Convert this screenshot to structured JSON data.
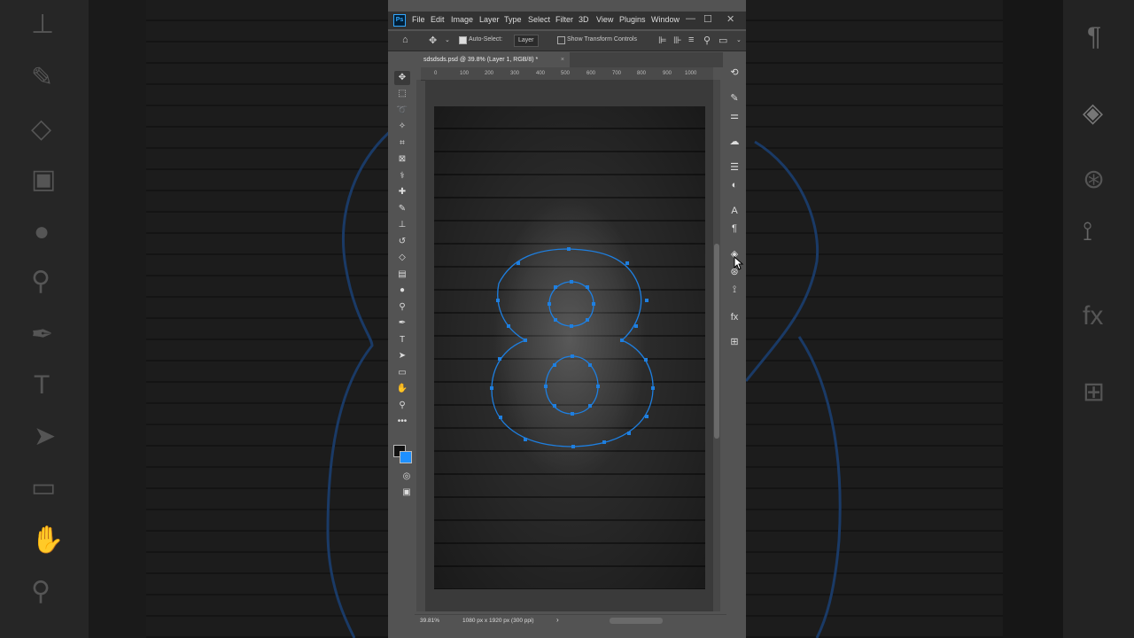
{
  "menu": {
    "logo": "Ps",
    "items": [
      "File",
      "Edit",
      "Image",
      "Layer",
      "Type",
      "Select",
      "Filter",
      "3D",
      "View",
      "Plugins",
      "Window"
    ],
    "minimize": "—",
    "maximize": "☐",
    "close": "✕"
  },
  "options_bar": {
    "auto_select_label": "Auto-Select:",
    "auto_select_value": "Layer",
    "show_transform_label": "Show Transform Controls"
  },
  "document": {
    "tab_title": "sdsdsds.psd @ 39.8% (Layer 1, RGB/8) *",
    "close": "×",
    "zoom": "39.81%",
    "dimensions": "1080 px x 1920 px (300 ppi)",
    "status_arrow": "›"
  },
  "ruler": {
    "h_ticks": [
      "0",
      "100",
      "200",
      "300",
      "400",
      "500",
      "600",
      "700",
      "800",
      "900",
      "1000"
    ]
  },
  "colors": {
    "foreground": "#111111",
    "background": "#1e90ff",
    "path_stroke": "#1e7fe0",
    "app_bg": "#535353"
  },
  "icons": {
    "tools": [
      "move-icon",
      "marquee-icon",
      "lasso-icon",
      "magic-wand-icon",
      "crop-icon",
      "frame-icon",
      "eyedropper-icon",
      "healing-brush-icon",
      "brush-icon",
      "clone-stamp-icon",
      "history-brush-icon",
      "eraser-icon",
      "gradient-icon",
      "blur-icon",
      "dodge-icon",
      "pen-icon",
      "type-icon",
      "path-selection-icon",
      "rectangle-icon",
      "hand-icon",
      "zoom-icon",
      "more-tools-icon"
    ],
    "panels": [
      "history-icon",
      "brush-settings-icon",
      "adjustments-icon",
      "libraries-icon",
      "properties-icon",
      "color-icon",
      "character-icon",
      "paragraph-icon",
      "layers-icon",
      "channels-icon",
      "paths-icon",
      "styles-icon",
      "timeline-icon"
    ]
  }
}
